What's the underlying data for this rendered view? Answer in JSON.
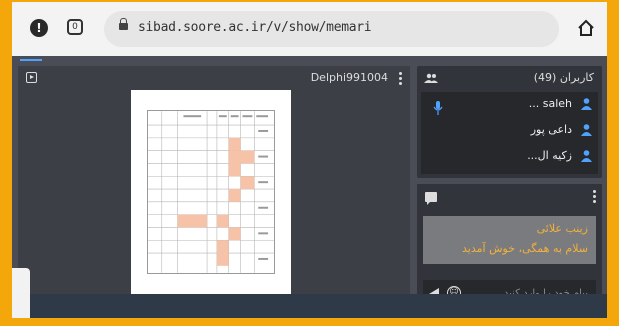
{
  "browser": {
    "url": "sibad.soore.ac.ir/v/show/memari",
    "info_icon": "alert-circle-icon",
    "tabs_icon_count": "0",
    "home_icon": "home-icon"
  },
  "presentation": {
    "title": "Delphi991004"
  },
  "users": {
    "title": "کاربران (49)",
    "list": [
      {
        "name": "saleh ..."
      },
      {
        "name": "داعی پور"
      },
      {
        "name": "زکیه ال..."
      }
    ]
  },
  "chat": {
    "sender": "زینب علائی",
    "message": "سلام به همگی، خوش آمدید",
    "placeholder": "پیام خود را وارد کنید"
  },
  "colors": {
    "frame": "#f4a70b",
    "panel_bg": "#3c3f46",
    "accent_blue": "#4fa3ff",
    "chat_text": "#f2b13a",
    "highlight_cell": "#f6c3a8"
  }
}
